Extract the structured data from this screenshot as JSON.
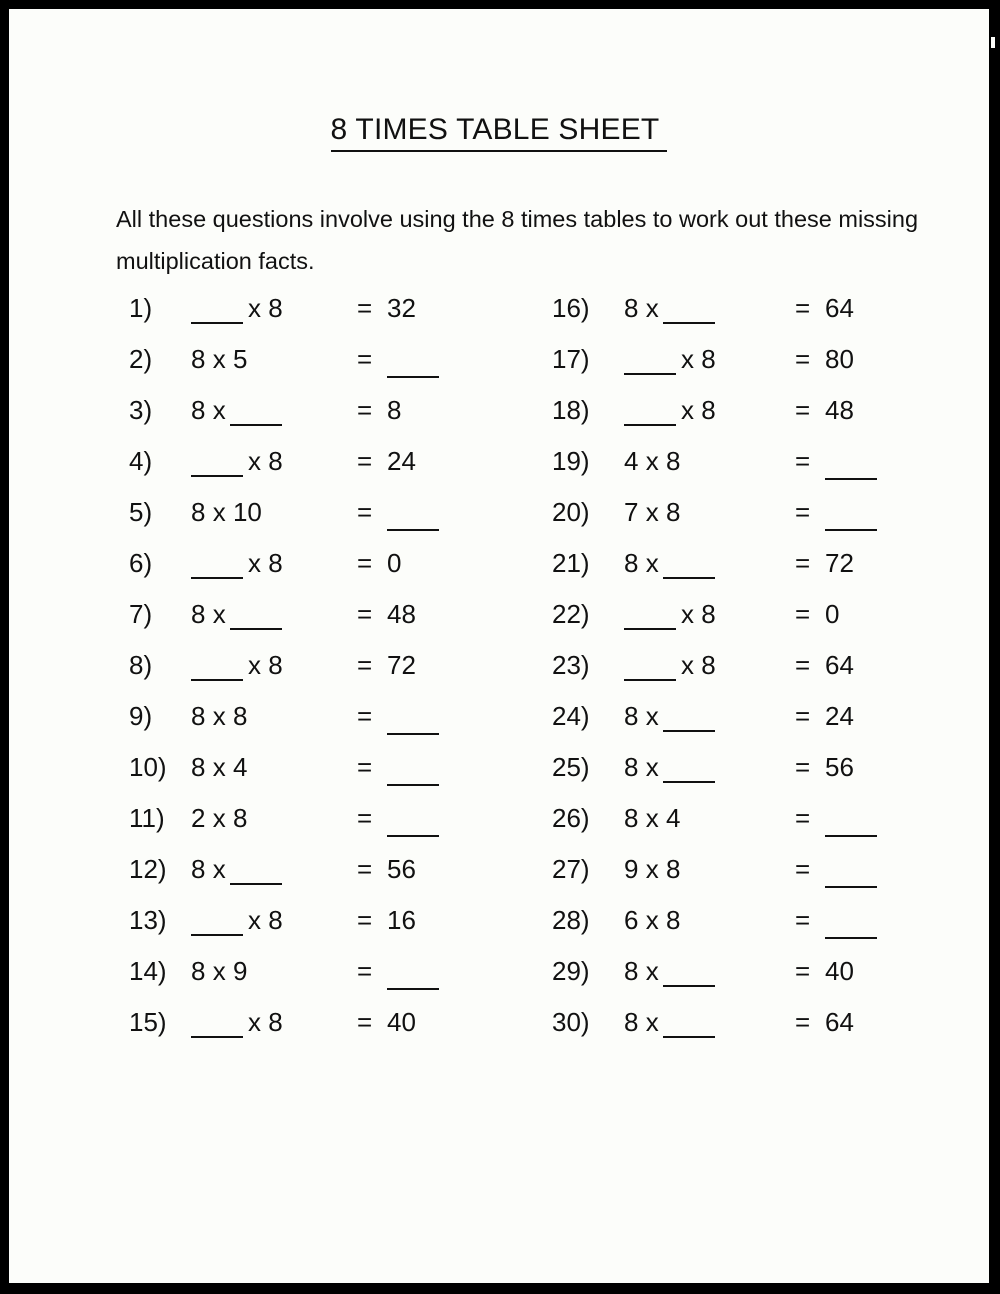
{
  "page": {
    "title": "8 TIMES TABLE SHEET ",
    "intro": "All these questions involve using the 8 times tables to work out these missing multiplication facts.",
    "equals_sign": "=",
    "times_sign": "x",
    "page_background": "#fcfdfa",
    "border_color": "#000000",
    "ink_color": "#111111"
  },
  "questions": {
    "left_column": [
      {
        "number": "1)",
        "left": "",
        "right": "8",
        "answer": "32"
      },
      {
        "number": "2)",
        "left": "8",
        "right": "5",
        "answer": ""
      },
      {
        "number": "3)",
        "left": "8",
        "right": "",
        "answer": "8"
      },
      {
        "number": "4)",
        "left": "",
        "right": "8",
        "answer": "24"
      },
      {
        "number": "5)",
        "left": "8",
        "right": "10",
        "answer": ""
      },
      {
        "number": "6)",
        "left": "",
        "right": "8",
        "answer": "0"
      },
      {
        "number": "7)",
        "left": "8",
        "right": "",
        "answer": "48"
      },
      {
        "number": "8)",
        "left": "",
        "right": "8",
        "answer": "72"
      },
      {
        "number": "9)",
        "left": "8",
        "right": "8",
        "answer": ""
      },
      {
        "number": "10)",
        "left": "8",
        "right": "4",
        "answer": ""
      },
      {
        "number": "11)",
        "left": "2",
        "right": "8",
        "answer": ""
      },
      {
        "number": "12)",
        "left": "8",
        "right": "",
        "answer": "56"
      },
      {
        "number": "13)",
        "left": "",
        "right": "8",
        "answer": "16"
      },
      {
        "number": "14)",
        "left": "8",
        "right": "9",
        "answer": ""
      },
      {
        "number": "15)",
        "left": "",
        "right": "8",
        "answer": "40"
      }
    ],
    "right_column": [
      {
        "number": "16)",
        "left": "8",
        "right": "",
        "answer": "64"
      },
      {
        "number": "17)",
        "left": "",
        "right": "8",
        "answer": "80"
      },
      {
        "number": "18)",
        "left": "",
        "right": "8",
        "answer": "48"
      },
      {
        "number": "19)",
        "left": "4",
        "right": "8",
        "answer": ""
      },
      {
        "number": "20)",
        "left": "7",
        "right": "8",
        "answer": ""
      },
      {
        "number": "21)",
        "left": "8",
        "right": "",
        "answer": "72"
      },
      {
        "number": "22)",
        "left": "",
        "right": "8",
        "answer": "0"
      },
      {
        "number": "23)",
        "left": "",
        "right": "8",
        "answer": "64"
      },
      {
        "number": "24)",
        "left": "8",
        "right": "",
        "answer": "24"
      },
      {
        "number": "25)",
        "left": "8",
        "right": "",
        "answer": "56"
      },
      {
        "number": "26)",
        "left": "8",
        "right": "4",
        "answer": ""
      },
      {
        "number": "27)",
        "left": "9",
        "right": "8",
        "answer": ""
      },
      {
        "number": "28)",
        "left": "6",
        "right": "8",
        "answer": ""
      },
      {
        "number": "29)",
        "left": "8",
        "right": "",
        "answer": "40"
      },
      {
        "number": "30)",
        "left": "8",
        "right": "",
        "answer": "64"
      }
    ]
  }
}
